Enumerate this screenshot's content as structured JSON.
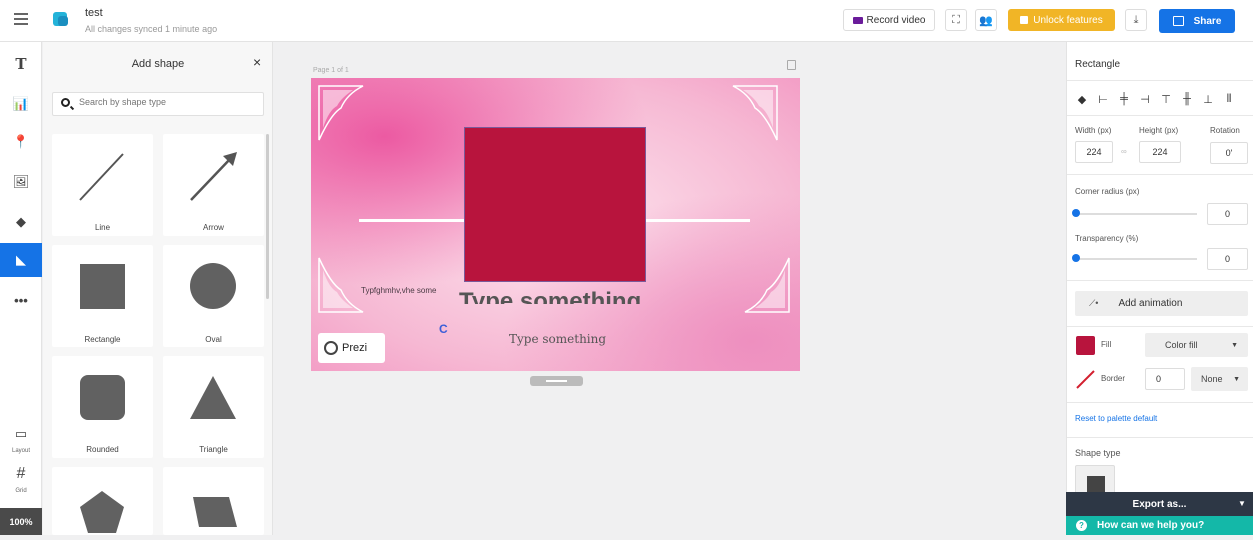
{
  "topbar": {
    "doc_title": "test",
    "sync_status": "All changes synced 1 minute ago",
    "record_label": "Record video",
    "unlock_label": "Unlock features",
    "share_label": "Share"
  },
  "shape_panel": {
    "title": "Add shape",
    "close_glyph": "×",
    "search_placeholder": "Search by shape type",
    "shapes": [
      {
        "label": "Line"
      },
      {
        "label": "Arrow"
      },
      {
        "label": "Rectangle"
      },
      {
        "label": "Oval"
      },
      {
        "label": "Rounded"
      },
      {
        "label": "Triangle"
      }
    ]
  },
  "left_rail": {
    "layout_label": "Layout",
    "grid_label": "Grid",
    "zoom": "100%"
  },
  "canvas": {
    "page_label": "Page 1 of 1",
    "small_text": "Typfghmhv,vhe some",
    "big_text": "Type something",
    "subtitle": "Type something",
    "prezi_label": "Prezi",
    "spinner_glyph": "C"
  },
  "props": {
    "title": "Rectangle",
    "width_label": "Width (px)",
    "height_label": "Height (px)",
    "rotation_label": "Rotation",
    "width": "224",
    "height": "224",
    "rotation": "0'",
    "link_glyph": "∞",
    "corner_label": "Corner radius (px)",
    "corner_value": "0",
    "transparency_label": "Transparency (%)",
    "transparency_value": "0",
    "add_animation": "Add animation",
    "fill_label": "Fill",
    "fill_mode": "Color fill",
    "fill_color": "#b8143d",
    "border_label": "Border",
    "border_width": "0",
    "border_style": "None",
    "reset_label": "Reset to palette default",
    "shape_type_label": "Shape type"
  },
  "export": {
    "label": "Export as...",
    "help": "How can we help you?"
  }
}
